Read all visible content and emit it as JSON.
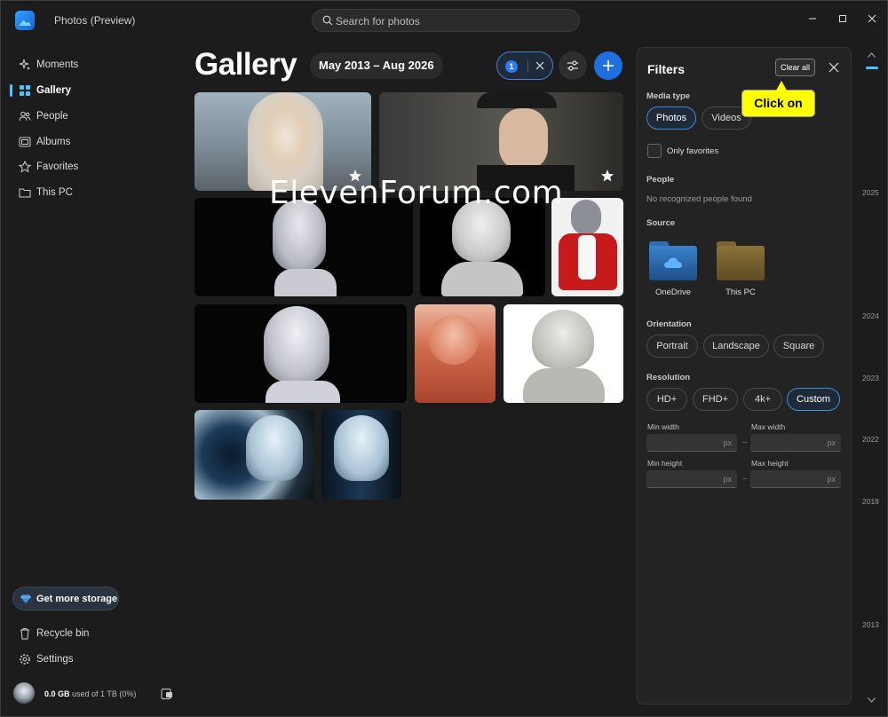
{
  "app": {
    "title": "Photos (Preview)"
  },
  "search": {
    "placeholder": "Search for photos"
  },
  "sidebar": {
    "items": [
      {
        "label": "Moments",
        "icon": "sparkle-icon"
      },
      {
        "label": "Gallery",
        "icon": "gallery-grid-icon"
      },
      {
        "label": "People",
        "icon": "people-icon"
      },
      {
        "label": "Albums",
        "icon": "albums-icon"
      },
      {
        "label": "Favorites",
        "icon": "star-icon"
      },
      {
        "label": "This PC",
        "icon": "folder-icon"
      }
    ],
    "storage_button": "Get more storage",
    "recycle": "Recycle bin",
    "settings": "Settings",
    "usage_amount": "0.0 GB",
    "usage_rest": "used of 1 TB (0%)"
  },
  "main": {
    "title": "Gallery",
    "date_range": "May 2013 – Aug 2026",
    "filter_count": "1"
  },
  "watermark": "ElevenForum.com",
  "filters": {
    "title": "Filters",
    "clear_all": "Clear all",
    "media_type_label": "Media type",
    "media_types": [
      "Photos",
      "Videos"
    ],
    "media_selected": "Photos",
    "only_favorites": "Only favorites",
    "people_label": "People",
    "people_empty": "No recognized people found",
    "source_label": "Source",
    "sources": [
      "OneDrive",
      "This PC"
    ],
    "orientation_label": "Orientation",
    "orientations": [
      "Portrait",
      "Landscape",
      "Square"
    ],
    "resolution_label": "Resolution",
    "resolutions": [
      "HD+",
      "FHD+",
      "4k+",
      "Custom"
    ],
    "resolution_selected": "Custom",
    "min_width": "Min width",
    "max_width": "Max width",
    "min_height": "Min height",
    "max_height": "Max height",
    "unit": "px",
    "dash": "–"
  },
  "callout": "Click on",
  "timeline": {
    "years": [
      "2025",
      "2024",
      "2023",
      "2022",
      "2018",
      "2013"
    ]
  },
  "colors": {
    "accent": "#4cc2ff",
    "primary_button": "#1f6fe0",
    "callout": "#ffff00"
  }
}
